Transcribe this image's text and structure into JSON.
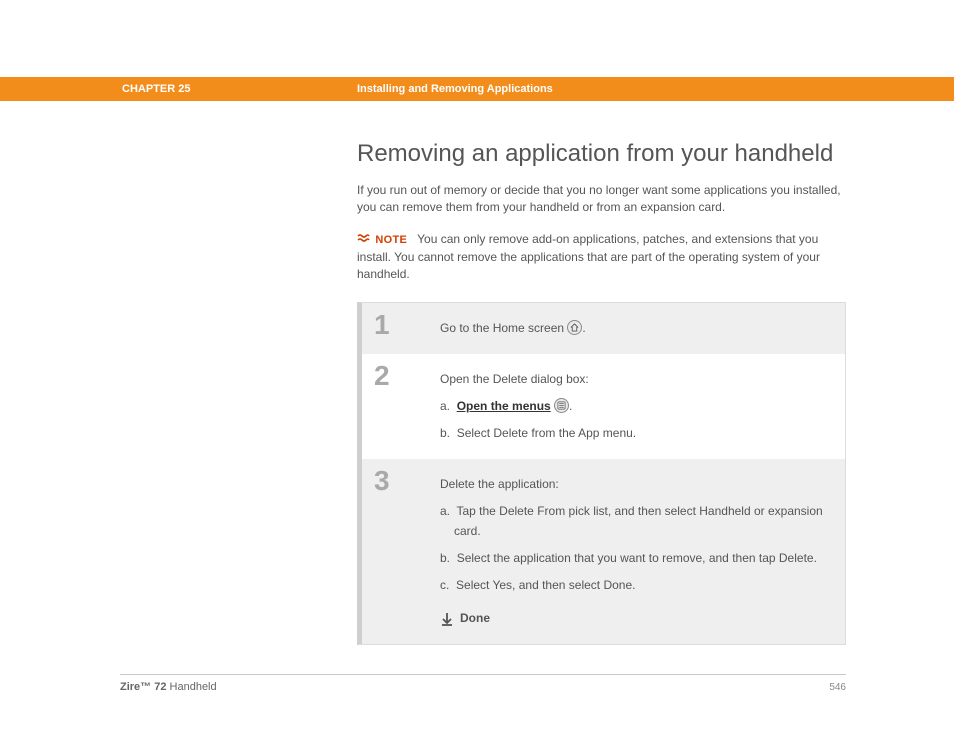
{
  "header": {
    "chapter": "CHAPTER 25",
    "title": "Installing and Removing Applications"
  },
  "main": {
    "title": "Removing an application from your handheld",
    "intro": "If you run out of memory or decide that you no longer want some applications you installed, you can remove them from your handheld or from an expansion card.",
    "note_label": "NOTE",
    "note_text": "You can only remove add-on applications, patches, and extensions that you install. You cannot remove the applications that are part of the operating system of your handheld."
  },
  "steps": [
    {
      "num": "1",
      "lead": "Go to the Home screen",
      "after_icon": "."
    },
    {
      "num": "2",
      "lead": "Open the Delete dialog box:",
      "items": [
        {
          "prefix": "a.",
          "link": "Open the menus",
          "has_icon": true,
          "after": "."
        },
        {
          "prefix": "b.",
          "text": "Select Delete from the App menu."
        }
      ]
    },
    {
      "num": "3",
      "lead": "Delete the application:",
      "items": [
        {
          "prefix": "a.",
          "text": "Tap the Delete From pick list, and then select Handheld or expansion card."
        },
        {
          "prefix": "b.",
          "text": "Select the application that you want to remove, and then tap Delete."
        },
        {
          "prefix": "c.",
          "text": "Select Yes, and then select Done."
        }
      ],
      "done": "Done"
    }
  ],
  "footer": {
    "brand": "Zire™ 72",
    "product": " Handheld",
    "page": "546"
  }
}
